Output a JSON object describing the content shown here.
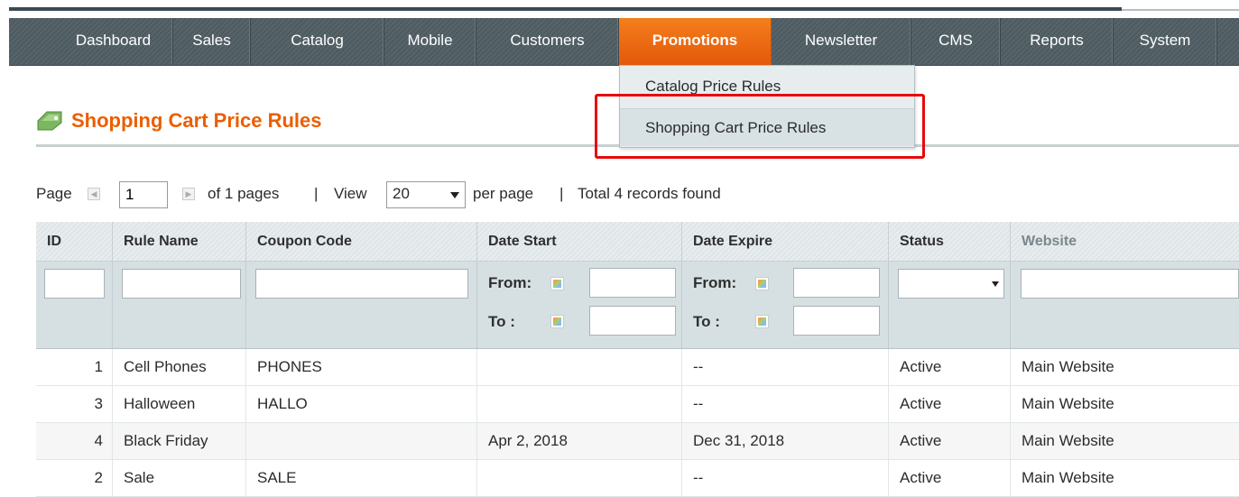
{
  "nav": {
    "items": [
      {
        "label": "Dashboard"
      },
      {
        "label": "Sales"
      },
      {
        "label": "Catalog"
      },
      {
        "label": "Mobile"
      },
      {
        "label": "Customers"
      },
      {
        "label": "Promotions",
        "active": true
      },
      {
        "label": "Newsletter"
      },
      {
        "label": "CMS"
      },
      {
        "label": "Reports"
      },
      {
        "label": "System"
      }
    ],
    "dropdown": [
      "Catalog Price Rules",
      "Shopping Cart Price Rules"
    ]
  },
  "page": {
    "title": "Shopping Cart Price Rules",
    "title_icon": "tag-icon"
  },
  "pager": {
    "page_label": "Page",
    "page_value": "1",
    "of_pages": "of 1 pages",
    "sep1": "|",
    "view_label": "View",
    "view_value": "20",
    "per_page": "per page",
    "sep2": "|",
    "total": "Total 4 records found"
  },
  "grid": {
    "columns": [
      "ID",
      "Rule Name",
      "Coupon Code",
      "Date Start",
      "Date Expire",
      "Status",
      "Website"
    ],
    "filters": {
      "from_label": "From:",
      "to_label": "To :"
    },
    "rows": [
      {
        "id": "1",
        "name": "Cell Phones",
        "coupon": "PHONES",
        "start": "",
        "expire": "--",
        "status": "Active",
        "website": "Main Website"
      },
      {
        "id": "3",
        "name": "Halloween",
        "coupon": "HALLO",
        "start": "",
        "expire": "--",
        "status": "Active",
        "website": "Main Website"
      },
      {
        "id": "4",
        "name": "Black Friday",
        "coupon": "",
        "start": "Apr 2, 2018",
        "expire": "Dec 31, 2018",
        "status": "Active",
        "website": "Main Website"
      },
      {
        "id": "2",
        "name": "Sale",
        "coupon": "SALE",
        "start": "",
        "expire": "--",
        "status": "Active",
        "website": "Main Website"
      }
    ]
  },
  "colors": {
    "accent": "#eb5e00",
    "nav_active": "#e86a12",
    "nav_bg": "#525f65",
    "highlight_box": "#e80a0a"
  }
}
